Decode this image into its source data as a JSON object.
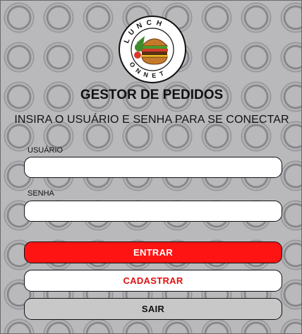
{
  "header": {
    "logo_top_text": "LUNCH",
    "logo_bottom_text": "O N N E T",
    "title": "GESTOR DE PEDIDOS",
    "subtitle": "INSIRA O USUÁRIO E SENHA PARA SE CONECTAR"
  },
  "form": {
    "user_label": "USUÁRIO",
    "user_value": "",
    "password_label": "SENHA",
    "password_value": ""
  },
  "buttons": {
    "enter": "ENTRAR",
    "register": "CADASTRAR",
    "exit": "SAIR"
  },
  "colors": {
    "background": "#b9b9bb",
    "enter_button": "#ff1414",
    "register_text": "#e01010",
    "exit_button": "#c8c8c8"
  }
}
